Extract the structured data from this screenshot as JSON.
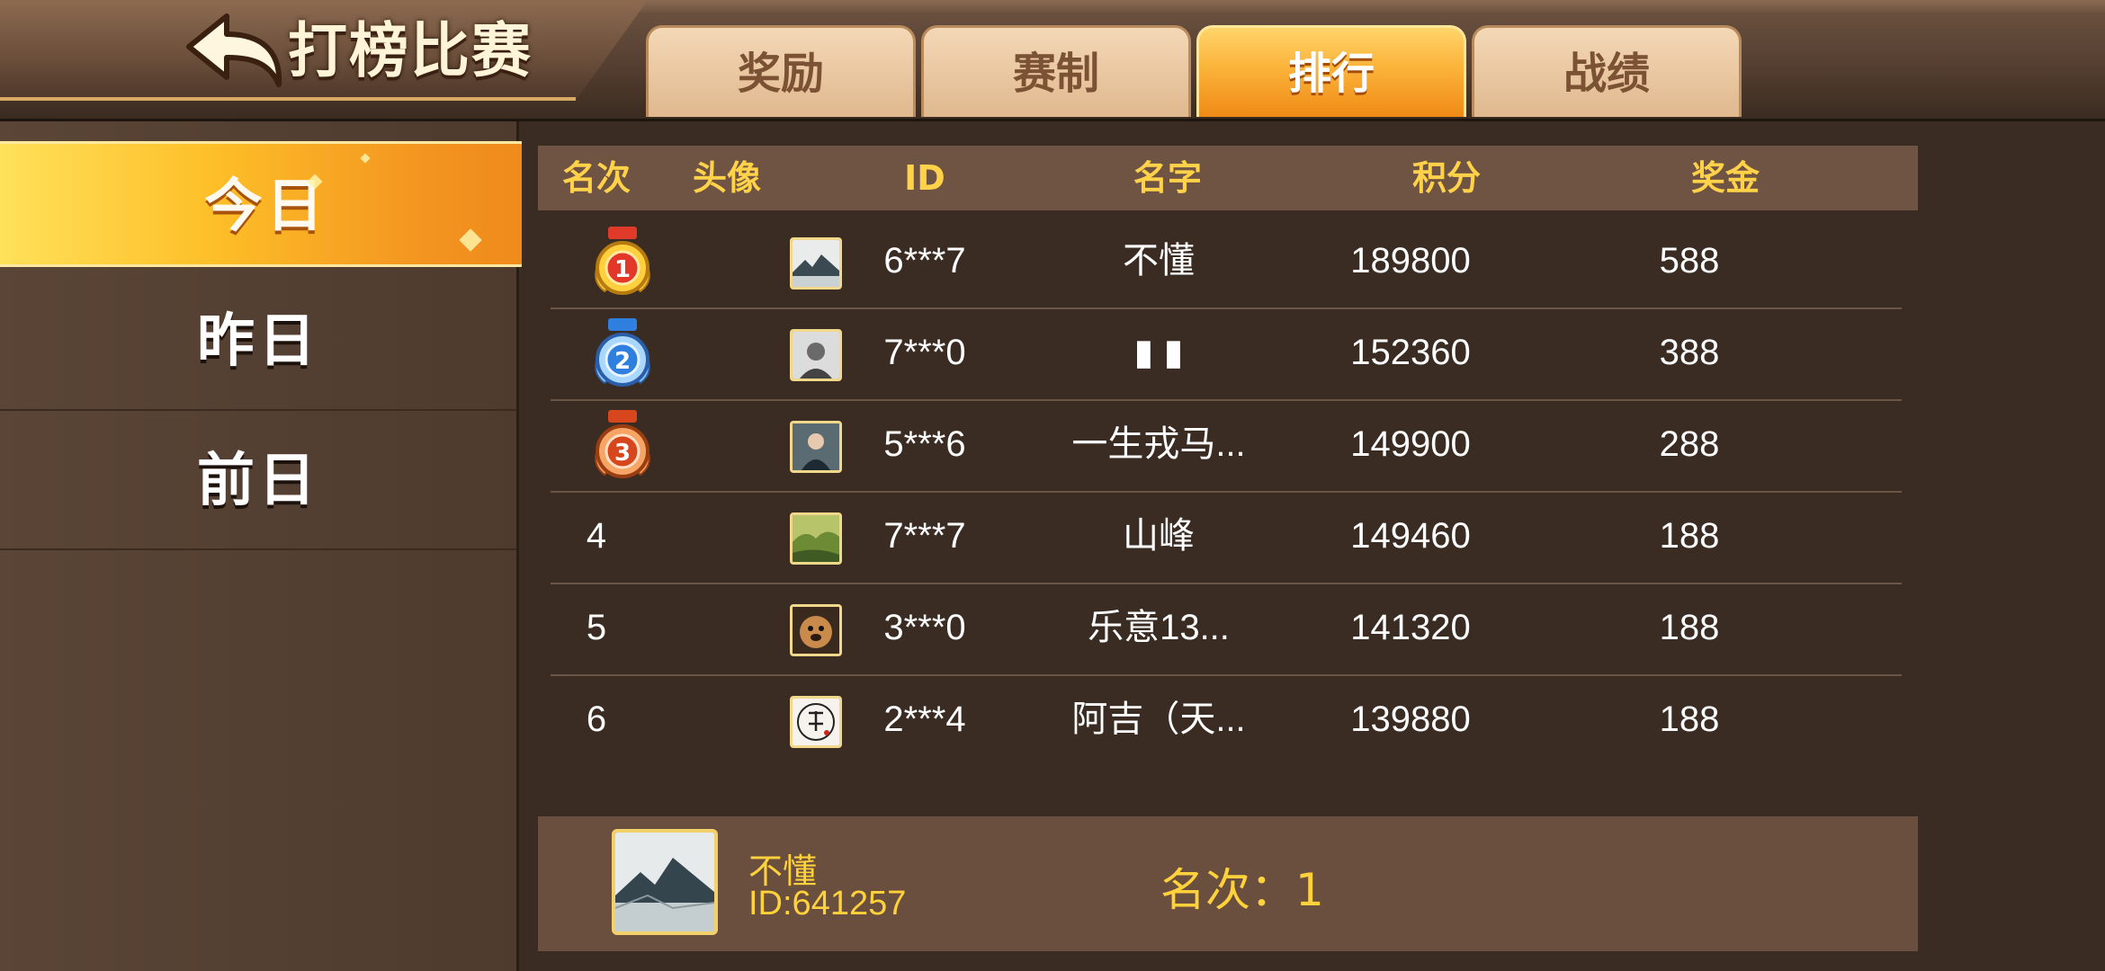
{
  "header": {
    "title": "打榜比赛",
    "tabs": [
      {
        "label": "奖励",
        "active": false
      },
      {
        "label": "赛制",
        "active": false
      },
      {
        "label": "排行",
        "active": true
      },
      {
        "label": "战绩",
        "active": false
      }
    ]
  },
  "sidebar": {
    "items": [
      {
        "label": "今日",
        "active": true
      },
      {
        "label": "昨日",
        "active": false
      },
      {
        "label": "前日",
        "active": false
      }
    ]
  },
  "table": {
    "columns": [
      "名次",
      "头像",
      "ID",
      "名字",
      "积分",
      "奖金"
    ],
    "rows": [
      {
        "rank": "1",
        "medal": "gold-medal-icon",
        "id": "6***7",
        "name": "不懂",
        "score": "189800",
        "prize": "588",
        "avatar": "mountain-avatar"
      },
      {
        "rank": "2",
        "medal": "silver-medal-icon",
        "id": "7***0",
        "name": "▮ ▮",
        "score": "152360",
        "prize": "388",
        "avatar": "portrait-avatar"
      },
      {
        "rank": "3",
        "medal": "bronze-medal-icon",
        "id": "5***6",
        "name": "一生戎马...",
        "score": "149900",
        "prize": "288",
        "avatar": "person-avatar"
      },
      {
        "rank": "4",
        "medal": "",
        "id": "7***7",
        "name": "山峰",
        "score": "149460",
        "prize": "188",
        "avatar": "landscape-avatar"
      },
      {
        "rank": "5",
        "medal": "",
        "id": "3***0",
        "name": "乐意13...",
        "score": "141320",
        "prize": "188",
        "avatar": "dog-avatar"
      },
      {
        "rank": "6",
        "medal": "",
        "id": "2***4",
        "name": "阿吉（天...",
        "score": "139880",
        "prize": "188",
        "avatar": "calligraphy-avatar"
      }
    ]
  },
  "self": {
    "name": "不懂",
    "id": "ID:641257",
    "rank_text": "名次：1"
  },
  "colors": {
    "accent": "#ffd24a",
    "active_tab": "#fbb33a",
    "background": "#3a2c23"
  }
}
